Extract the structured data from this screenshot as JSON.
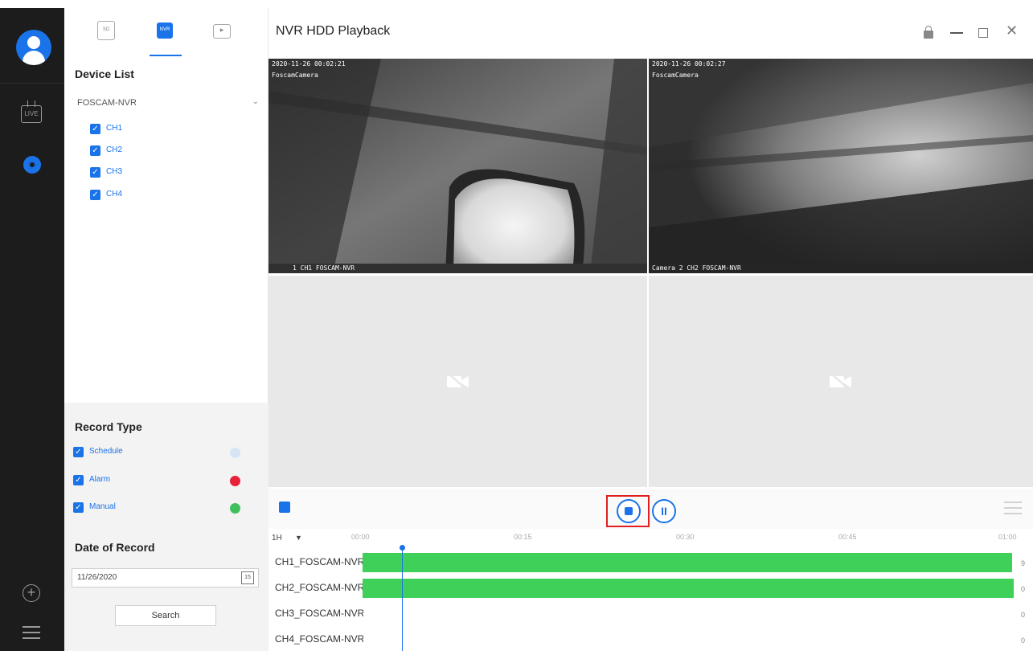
{
  "window": {
    "title": "NVR HDD Playback"
  },
  "left_tabs": {
    "sd": "SD",
    "nvr": "NVR"
  },
  "rail": {
    "live_label": "LIVE"
  },
  "device_list": {
    "title": "Device List",
    "device_name": "FOSCAM-NVR",
    "channels": [
      {
        "label": "CH1",
        "checked": true
      },
      {
        "label": "CH2",
        "checked": true
      },
      {
        "label": "CH3",
        "checked": true
      },
      {
        "label": "CH4",
        "checked": true
      }
    ]
  },
  "record_type": {
    "title": "Record Type",
    "items": [
      {
        "label": "Schedule",
        "color": "#d6e4f5"
      },
      {
        "label": "Alarm",
        "color": "#e8203a"
      },
      {
        "label": "Manual",
        "color": "#3fc05a"
      }
    ]
  },
  "date_of_record": {
    "title": "Date of Record",
    "value": "11/26/2020",
    "calendar_label": "15",
    "search_label": "Search"
  },
  "videos": [
    {
      "timestamp": "2020-11-26 00:02:21",
      "camera_name": "FoscamCamera",
      "footer": "1 CH1 FOSCAM-NVR"
    },
    {
      "timestamp": "2020-11-26 00:02:27",
      "camera_name": "FoscamCamera",
      "footer": "Camera 2 CH2 FOSCAM-NVR"
    }
  ],
  "timeline": {
    "zoom": "1H",
    "tick_labels": [
      "00:00",
      "00:15",
      "00:30",
      "00:45",
      "01:00"
    ],
    "channels": [
      {
        "label": "CH1_FOSCAM-NVR",
        "end": "9",
        "has_record": true
      },
      {
        "label": "CH2_FOSCAM-NVR",
        "end": "0",
        "has_record": true
      },
      {
        "label": "CH3_FOSCAM-NVR",
        "end": "0",
        "has_record": false
      },
      {
        "label": "CH4_FOSCAM-NVR",
        "end": "0",
        "has_record": false
      }
    ],
    "record_color": "#3fd05a",
    "accent": "#1a73e8"
  }
}
